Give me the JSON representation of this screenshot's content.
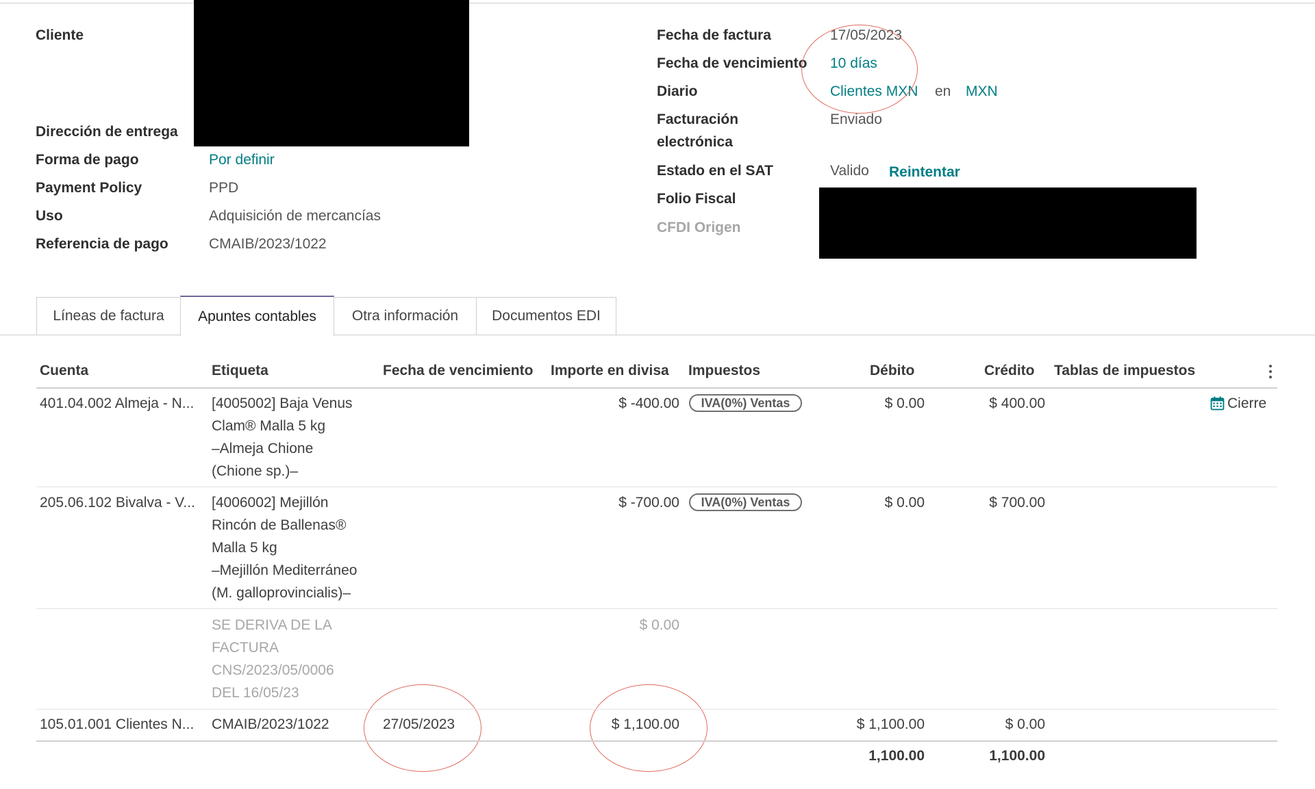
{
  "left_fields": {
    "cliente_label": "Cliente",
    "direccion_label": "Dirección de entrega",
    "forma_label": "Forma de pago",
    "forma_value": "Por definir",
    "policy_label": "Payment Policy",
    "policy_value": "PPD",
    "uso_label": "Uso",
    "uso_value": "Adquisición de mercancías",
    "referencia_label": "Referencia de pago",
    "referencia_value": "CMAIB/2023/1022"
  },
  "right_fields": {
    "fecha_label": "Fecha de factura",
    "fecha_value": "17/05/2023",
    "vencimiento_label": "Fecha de vencimiento",
    "vencimiento_value": "10 días",
    "diario_label": "Diario",
    "diario_value": "Clientes MXN",
    "diario_en": "en",
    "diario_currency": "MXN",
    "facturacion_label_1": "Facturación",
    "facturacion_label_2": "electrónica",
    "facturacion_value": "Enviado",
    "sat_label": "Estado en el SAT",
    "sat_value": "Valido",
    "sat_action": "Reintentar",
    "folio_label": "Folio Fiscal",
    "cfdi_label": "CFDI Origen"
  },
  "tabs": [
    {
      "label": "Líneas de factura",
      "active": false
    },
    {
      "label": "Apuntes contables",
      "active": true
    },
    {
      "label": "Otra información",
      "active": false
    },
    {
      "label": "Documentos EDI",
      "active": false
    }
  ],
  "table": {
    "headers": [
      "Cuenta",
      "Etiqueta",
      "Fecha de vencimiento",
      "Importe en divisa",
      "Impuestos",
      "Débito",
      "Crédito",
      "Tablas de impuestos"
    ],
    "rows": [
      {
        "cuenta": "401.04.002 Almeja - N...",
        "etiqueta": [
          "[4005002] Baja Venus",
          "Clam® Malla 5 kg",
          "–Almeja Chione",
          "(Chione sp.)–"
        ],
        "fecha": "",
        "importe": "$ -400.00",
        "impuesto": "IVA(0%) Ventas",
        "debito": "$ 0.00",
        "credito": "$ 400.00",
        "tabla": "Cierre"
      },
      {
        "cuenta": "205.06.102 Bivalva - V...",
        "etiqueta": [
          "[4006002] Mejillón",
          "Rincón de Ballenas®",
          "Malla 5 kg",
          "–Mejillón Mediterráneo",
          "(M. galloprovincialis)–"
        ],
        "fecha": "",
        "importe": "$ -700.00",
        "impuesto": "IVA(0%) Ventas",
        "debito": "$ 0.00",
        "credito": "$ 700.00",
        "tabla": ""
      },
      {
        "cuenta": "",
        "etiqueta": [
          "SE DERIVA DE LA",
          "FACTURA",
          "CNS/2023/05/0006",
          "DEL 16/05/23"
        ],
        "fecha": "",
        "importe": "$ 0.00",
        "impuesto": "",
        "debito": "",
        "credito": "",
        "tabla": ""
      },
      {
        "cuenta": "105.01.001 Clientes N...",
        "etiqueta": [
          "CMAIB/2023/1022"
        ],
        "fecha": "27/05/2023",
        "importe": "$ 1,100.00",
        "impuesto": "",
        "debito": "$ 1,100.00",
        "credito": "$ 0.00",
        "tabla": ""
      }
    ],
    "totals": {
      "debito": "1,100.00",
      "credito": "1,100.00"
    }
  },
  "icons": {
    "calendar": "calendar-icon",
    "kebab": "kebab-menu-icon"
  },
  "colors": {
    "link": "#017e84",
    "active_tab": "#71639e",
    "annotation": "#e06a5a"
  }
}
